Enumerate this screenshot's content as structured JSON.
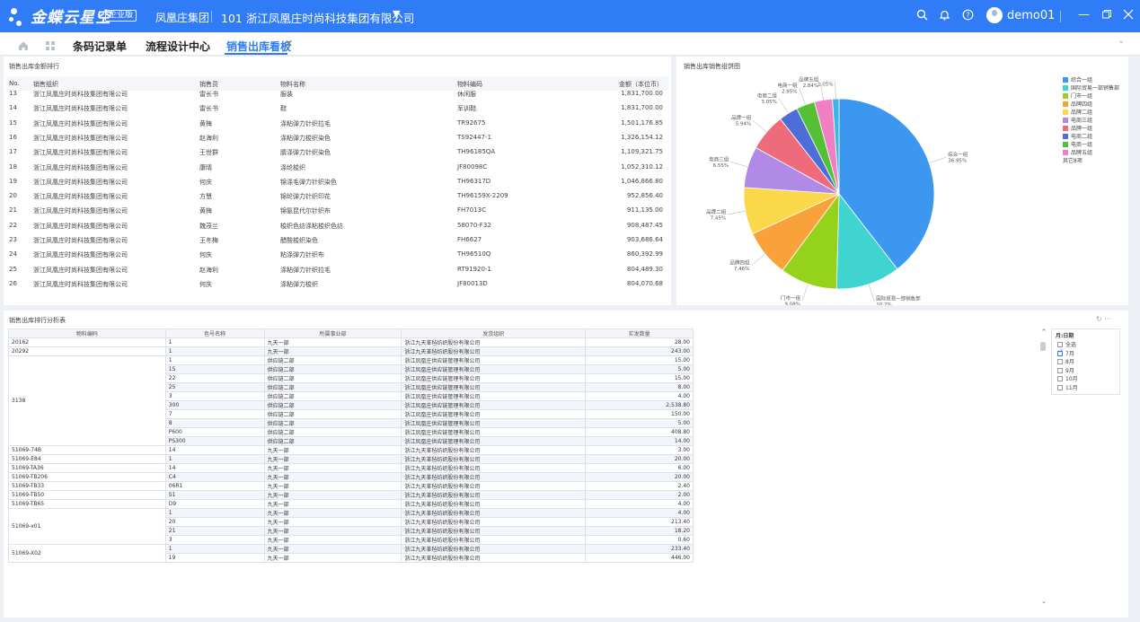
{
  "topbar": {
    "logo": "金蝶云星空",
    "badge": "企业版",
    "brand": "凤凰庄集团",
    "org": "101  浙江凤凰庄时尚科技集团有限公司",
    "username": "demo01",
    "bg_color": "#2f7cf6"
  },
  "tabs": [
    "条码记录单",
    "流程设计中心",
    "销售出库看板"
  ],
  "ranking": {
    "title": "销售出库金额排行",
    "headers": [
      "No.",
      "销售组织",
      "销售员",
      "物料名称",
      "物料编码",
      "金额（本位币）"
    ],
    "rows": [
      [
        "13",
        "浙江凤凰庄时尚科技集团有限公司",
        "雷长书",
        "服装",
        "休闲服",
        "1,831,700.00"
      ],
      [
        "14",
        "浙江凤凰庄时尚科技集团有限公司",
        "雷长书",
        "鞋",
        "军训鞋",
        "1,831,700.00"
      ],
      [
        "15",
        "浙江凤凰庄时尚科技集团有限公司",
        "黄梅",
        "涤粘弹力针织拉毛",
        "TR92675",
        "1,501,176.85"
      ],
      [
        "16",
        "浙江凤凰庄时尚科技集团有限公司",
        "赵海利",
        "涤粘弹力梭织染色",
        "TS92447-1",
        "1,326,154.12"
      ],
      [
        "17",
        "浙江凤凰庄时尚科技集团有限公司",
        "王世群",
        "腈涤弹力针织染色",
        "TH96185QA",
        "1,109,321.75"
      ],
      [
        "18",
        "浙江凤凰庄时尚科技集团有限公司",
        "康晴",
        "涤纶梭织",
        "JF80098C",
        "1,052,310.12"
      ],
      [
        "19",
        "浙江凤凰庄时尚科技集团有限公司",
        "何庆",
        "锦涤毛弹力针织染色",
        "TH96317D",
        "1,046,866.80"
      ],
      [
        "20",
        "浙江凤凰庄时尚科技集团有限公司",
        "方慧",
        "锦纶弹力针织印花",
        "TH96159X-2209",
        "952,856.40"
      ],
      [
        "21",
        "浙江凤凰庄时尚科技集团有限公司",
        "黄梅",
        "锦氨昆代尔针织布",
        "FH7013C",
        "911,135.00"
      ],
      [
        "22",
        "浙江凤凰庄时尚科技集团有限公司",
        "魏茂兰",
        "梭织色纺涤粘梭织色纺",
        "58070-F32",
        "908,487.45"
      ],
      [
        "23",
        "浙江凤凰庄时尚科技集团有限公司",
        "王冬梅",
        "醋酸梭织染色",
        "FH6627",
        "903,686.64"
      ],
      [
        "24",
        "浙江凤凰庄时尚科技集团有限公司",
        "何庆",
        "粘涤弹力针织布",
        "TH96510Q",
        "860,392.99"
      ],
      [
        "25",
        "浙江凤凰庄时尚科技集团有限公司",
        "赵海利",
        "涤粘弹力针织拉毛",
        "RT91920-1",
        "804,489.30"
      ],
      [
        "26",
        "浙江凤凰庄时尚科技集团有限公司",
        "何庆",
        "涤粘弹力梭织",
        "JF80013D",
        "804,070.68"
      ]
    ]
  },
  "pie": {
    "title": "销售出库销售组饼图",
    "chart_data": {
      "type": "pie",
      "labels": [
        "综合一组",
        "国际贸易一部销售部",
        "门市一组",
        "品牌四组",
        "品牌二组",
        "电商三组",
        "品牌一组",
        "电商二组",
        "电商一组",
        "品牌五组",
        "其它8项"
      ],
      "values": [
        36.95,
        10.2,
        9.08,
        7.46,
        7.45,
        6.55,
        5.94,
        3.05,
        2.95,
        2.84,
        1.05
      ],
      "value_labels": [
        "36.95%",
        "10.2%",
        "9.08%",
        "7.46%",
        "7.45%",
        "6.55%",
        "5.94%",
        "3.05%",
        "2.95%",
        "2.84%",
        "1.05%"
      ],
      "colors": [
        "#3c97f0",
        "#3fd4cf",
        "#94d21b",
        "#f9a23c",
        "#fbd84a",
        "#b08ae6",
        "#ee6b7c",
        "#4c6ed6",
        "#55c036",
        "#f07fc4",
        "#38b8e8",
        "#f4a640"
      ],
      "legend": [
        "综合一组",
        "国际贸易一部销售部",
        "门市一组",
        "品牌四组",
        "品牌二组",
        "电商三组",
        "品牌一组",
        "电商二组",
        "电商一组",
        "品牌五组",
        "其它8项"
      ],
      "legend_position": "top-right"
    }
  },
  "analysis": {
    "title": "销售出库排行分析表",
    "headers": [
      "物料编码",
      "色号名称",
      "所属事业部",
      "发货组织",
      "实发数量"
    ],
    "groups": [
      {
        "code": "20162",
        "rows": [
          [
            "1",
            "九天一部",
            "浙江九天革毡纺织股份有限公司",
            "28.00"
          ]
        ]
      },
      {
        "code": "20292",
        "rows": [
          [
            "1",
            "九天一部",
            "浙江九天革毡纺织股份有限公司",
            "243.00"
          ]
        ]
      },
      {
        "code": "3138",
        "rows": [
          [
            "1",
            "供应链二部",
            "浙江凤凰庄供应链管理有限公司",
            "15.00"
          ],
          [
            "15",
            "供应链二部",
            "浙江凤凰庄供应链管理有限公司",
            "5.00"
          ],
          [
            "22",
            "供应链二部",
            "浙江凤凰庄供应链管理有限公司",
            "15.00"
          ],
          [
            "25",
            "供应链二部",
            "浙江凤凰庄供应链管理有限公司",
            "8.00"
          ],
          [
            "3",
            "供应链二部",
            "浙江凤凰庄供应链管理有限公司",
            "4.00"
          ],
          [
            "300",
            "供应链二部",
            "浙江凤凰庄供应链管理有限公司",
            "2,538.80"
          ],
          [
            "7",
            "供应链二部",
            "浙江凤凰庄供应链管理有限公司",
            "150.00"
          ],
          [
            "8",
            "供应链二部",
            "浙江凤凰庄供应链管理有限公司",
            "5.00"
          ],
          [
            "P600",
            "供应链二部",
            "浙江凤凰庄供应链管理有限公司",
            "408.80"
          ],
          [
            "PS300",
            "供应链二部",
            "浙江凤凰庄供应链管理有限公司",
            "14.00"
          ]
        ]
      },
      {
        "code": "51069-74B",
        "rows": [
          [
            "14",
            "九天一部",
            "浙江九天革毡纺织股份有限公司",
            "3.00"
          ]
        ]
      },
      {
        "code": "51069-E84",
        "rows": [
          [
            "1",
            "九天一部",
            "浙江九天革毡纺织股份有限公司",
            "20.00"
          ]
        ]
      },
      {
        "code": "51069-TA36",
        "rows": [
          [
            "14",
            "九天一部",
            "浙江九天革毡纺织股份有限公司",
            "6.00"
          ]
        ]
      },
      {
        "code": "51069-TB206",
        "rows": [
          [
            "C4",
            "九天一部",
            "浙江九天革毡纺织股份有限公司",
            "20.00"
          ]
        ]
      },
      {
        "code": "51069-TB33",
        "rows": [
          [
            "06R1",
            "九天一部",
            "浙江九天革毡纺织股份有限公司",
            "2.40"
          ]
        ]
      },
      {
        "code": "51069-TB50",
        "rows": [
          [
            "S1",
            "九天一部",
            "浙江九天革毡纺织股份有限公司",
            "2.00"
          ]
        ]
      },
      {
        "code": "51069-TB65",
        "rows": [
          [
            "D9",
            "九天一部",
            "浙江九天革毡纺织股份有限公司",
            "4.00"
          ]
        ]
      },
      {
        "code": "51069-x01",
        "rows": [
          [
            "1",
            "九天一部",
            "浙江九天革毡纺织股份有限公司",
            "4.00"
          ],
          [
            "20",
            "九天一部",
            "浙江九天革毡纺织股份有限公司",
            "213.40"
          ],
          [
            "21",
            "九天一部",
            "浙江九天革毡纺织股份有限公司",
            "18.20"
          ],
          [
            "3",
            "九天一部",
            "浙江九天革毡纺织股份有限公司",
            "0.60"
          ]
        ]
      },
      {
        "code": "51069-X02",
        "rows": [
          [
            "1",
            "九天一部",
            "浙江九天革毡纺织股份有限公司",
            "233.40"
          ],
          [
            "19",
            "九天一部",
            "浙江九天革毡纺织股份有限公司",
            "446.00"
          ]
        ]
      }
    ]
  },
  "filter": {
    "title": "月:日期",
    "items": [
      {
        "label": "全选",
        "checked": false
      },
      {
        "label": "7月",
        "checked": true
      },
      {
        "label": "8月",
        "checked": false
      },
      {
        "label": "9月",
        "checked": false
      },
      {
        "label": "10月",
        "checked": false
      },
      {
        "label": "11月",
        "checked": false
      }
    ]
  }
}
